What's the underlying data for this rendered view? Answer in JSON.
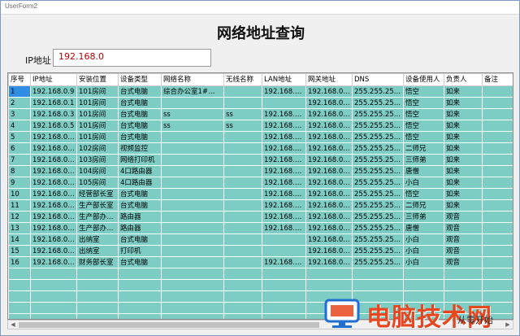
{
  "window": {
    "title": "UserForm2"
  },
  "page_title": "网络地址查询",
  "search": {
    "label": "IP地址",
    "value": "192.168.0"
  },
  "columns": [
    "序号",
    "IP地址",
    "安装位置",
    "设备类型",
    "网络名称",
    "无线名称",
    "LAN地址",
    "网关地址",
    "DNS",
    "设备使用人",
    "负责人",
    "备注"
  ],
  "rows": [
    [
      "1",
      "192.168.0.9",
      "101房间",
      "台式电脑",
      "综合办公室1#电脑",
      "",
      "192.168.1.9",
      "192.168.0.88",
      "255.255.255.0",
      "悟空",
      "如来",
      ""
    ],
    [
      "2",
      "192.168.0.1",
      "101房间",
      "台式电脑",
      "",
      "",
      "",
      "192.168.0.88",
      "255.255.255.0",
      "悟空",
      "如来",
      ""
    ],
    [
      "3",
      "192.168.0.3",
      "101房间",
      "台式电脑",
      "ss",
      "ss",
      "192.168.1.3",
      "192.168.0.88",
      "255.255.255.0",
      "悟空",
      "如来",
      ""
    ],
    [
      "4",
      "192.168.0.5",
      "101房间",
      "台式电脑",
      "ss",
      "ss",
      "192.168.1.3",
      "192.168.0.88",
      "255.255.255.0",
      "悟空",
      "如来",
      ""
    ],
    [
      "5",
      "192.168.0.10",
      "101房间",
      "台式电脑",
      "",
      "",
      "192.168.3.1",
      "192.168.0.88",
      "255.255.255.0",
      "悟空",
      "如来",
      ""
    ],
    [
      "6",
      "192.168.0.11",
      "102房间",
      "视频监控",
      "",
      "",
      "192.168.4.1",
      "192.168.0.88",
      "255.255.255.0",
      "二师兄",
      "如来",
      ""
    ],
    [
      "7",
      "192.168.0.12",
      "103房间",
      "网络打印机",
      "",
      "",
      "192.168.5.1",
      "192.168.0.88",
      "255.255.255.0",
      "三师弟",
      "如来",
      ""
    ],
    [
      "8",
      "192.168.0.13",
      "104房间",
      "4口路由器",
      "",
      "",
      "192.168.6.1",
      "192.168.0.88",
      "255.255.255.0",
      "唐僧",
      "如来",
      ""
    ],
    [
      "9",
      "192.168.0.14",
      "105房间",
      "4口路由器",
      "",
      "",
      "192.168.7.1",
      "192.168.0.88",
      "255.255.255.0",
      "小白",
      "如来",
      ""
    ],
    [
      "10",
      "192.168.0.15",
      "经营部长室",
      "台式电脑",
      "",
      "",
      "192.168.8.1",
      "192.168.0.88",
      "255.255.255.0",
      "悟空",
      "如来",
      ""
    ],
    [
      "11",
      "192.168.0.16",
      "生产部长室",
      "台式电脑",
      "",
      "",
      "192.168.9.1",
      "192.168.0.88",
      "255.255.255.0",
      "二师兄",
      "如来",
      ""
    ],
    [
      "12",
      "192.168.0.17",
      "生产部办公...",
      "路由器",
      "",
      "",
      "192.168.10.1",
      "192.168.0.88",
      "255.255.255.0",
      "三师弟",
      "观音",
      ""
    ],
    [
      "13",
      "192.168.0.18",
      "生产部办公...",
      "路由器",
      "",
      "",
      "192.168.11.1",
      "192.168.0.88",
      "255.255.255.0",
      "唐僧",
      "观音",
      ""
    ],
    [
      "14",
      "192.168.0.19",
      "出纳室",
      "台式电脑",
      "",
      "",
      "",
      "192.168.0.88",
      "255.255.255.0",
      "小白",
      "观音",
      ""
    ],
    [
      "15",
      "192.168.0.20",
      "出纳室",
      "打印机",
      "",
      "",
      "",
      "192.168.0.88",
      "255.255.255.0",
      "小白",
      "观音",
      ""
    ],
    [
      "16",
      "192.168.0.21",
      "财务部长室",
      "台式电脑",
      "",
      "",
      "192.168.14.1",
      "192.168.0.88",
      "255.255.255.0",
      "小白",
      "观音",
      ""
    ]
  ],
  "empty_rows": 7,
  "watermark": {
    "text": "电脑技术网",
    "small": "从零开始"
  },
  "colors": {
    "grid_bg": "#7ecdc4",
    "selection": "#2f8de4",
    "input_text": "#c00000"
  }
}
